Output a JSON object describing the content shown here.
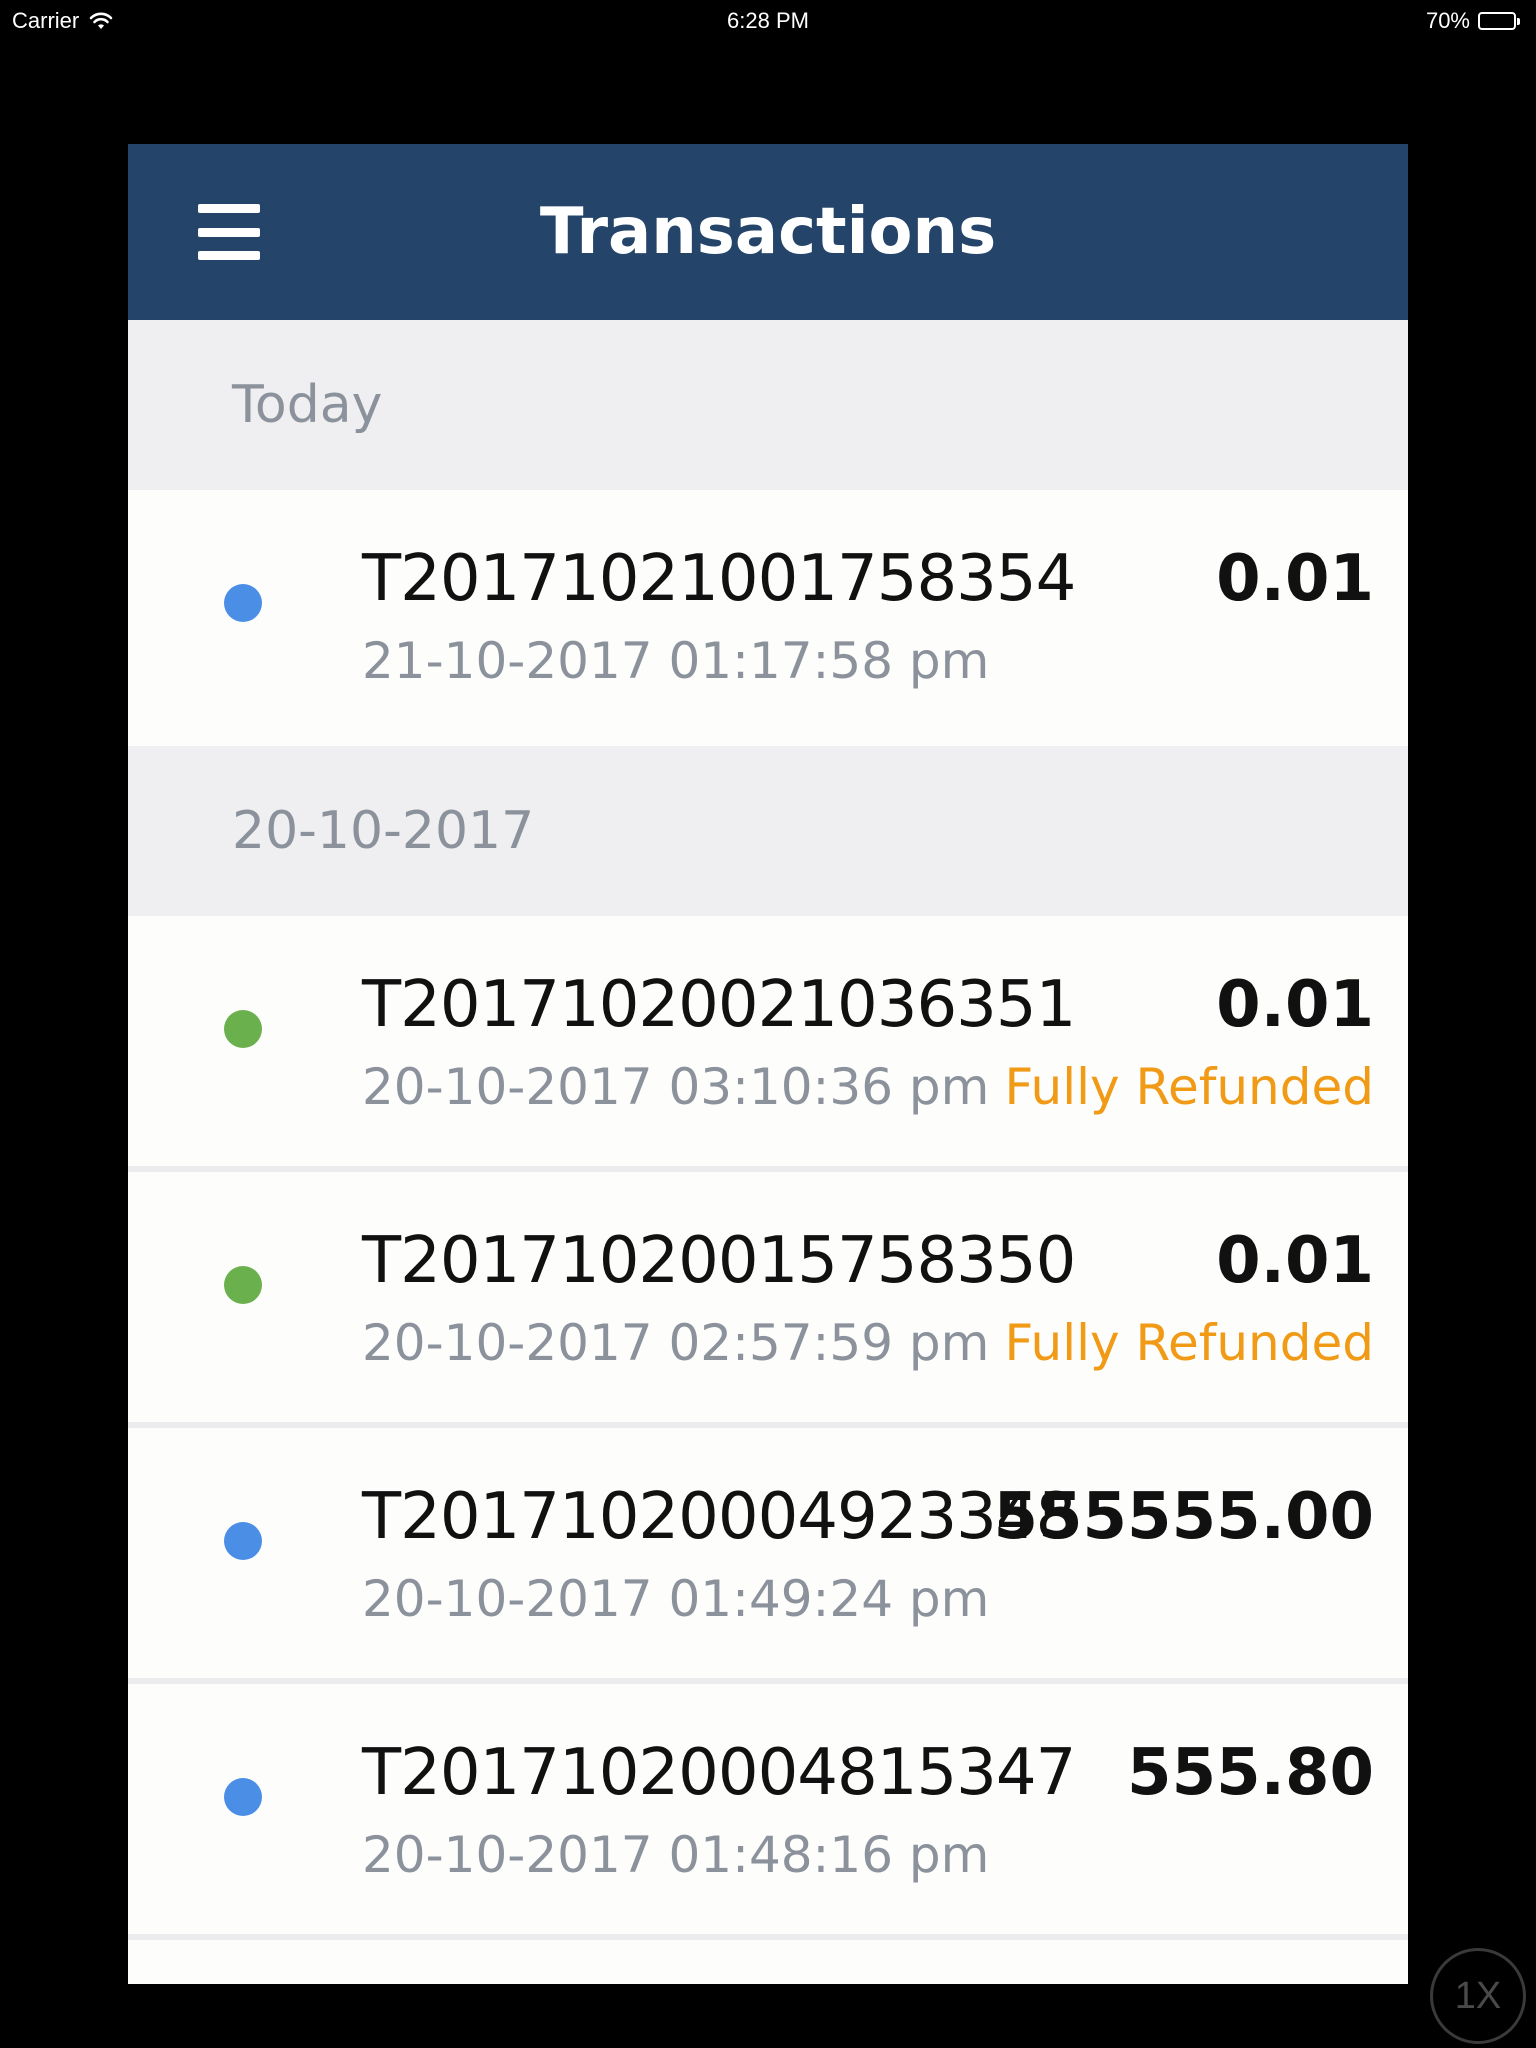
{
  "status_bar": {
    "carrier": "Carrier",
    "time": "6:28 PM",
    "battery": "70%",
    "battery_level": 0.7
  },
  "nav": {
    "title": "Transactions"
  },
  "sections": [
    {
      "header": "Today",
      "rows": [
        {
          "id": "T20171021001758354",
          "datetime": "21-10-2017 01:17:58 pm",
          "amount": "0.01",
          "status": "",
          "dot_color": "#4a8ee6"
        }
      ]
    },
    {
      "header": "20-10-2017",
      "rows": [
        {
          "id": "T20171020021036351",
          "datetime": "20-10-2017 03:10:36 pm",
          "amount": "0.01",
          "status": "Fully Refunded",
          "dot_color": "#6ab04c"
        },
        {
          "id": "T20171020015758350",
          "datetime": "20-10-2017 02:57:59 pm",
          "amount": "0.01",
          "status": "Fully Refunded",
          "dot_color": "#6ab04c"
        },
        {
          "id": "T20171020004923348",
          "datetime": "20-10-2017 01:49:24 pm",
          "amount": "555555.00",
          "status": "",
          "dot_color": "#4a8ee6"
        },
        {
          "id": "T20171020004815347",
          "datetime": "20-10-2017 01:48:16 pm",
          "amount": "555.80",
          "status": "",
          "dot_color": "#4a8ee6"
        }
      ]
    }
  ],
  "overlay": {
    "speed_label": "1X"
  }
}
